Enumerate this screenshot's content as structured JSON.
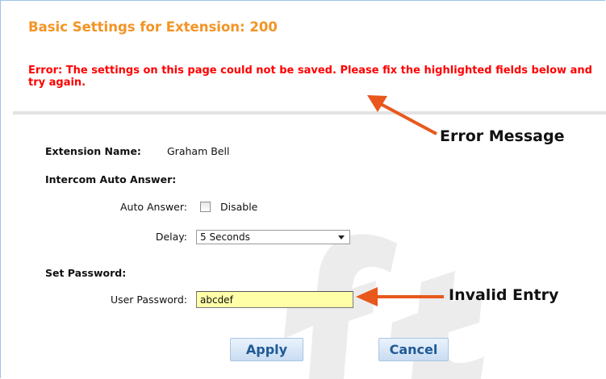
{
  "page": {
    "title": "Basic Settings for Extension: 200",
    "error_message": "Error: The settings on this page could not be saved. Please fix the highlighted fields below and try again."
  },
  "form": {
    "extension_name_label": "Extension Name:",
    "extension_name_value": "Graham Bell",
    "intercom_heading": "Intercom Auto Answer:",
    "auto_answer_label": "Auto Answer:",
    "auto_answer_checkbox_label": "Disable",
    "auto_answer_checked": false,
    "delay_label": "Delay:",
    "delay_value": "5 Seconds",
    "password_heading": "Set Password:",
    "user_password_label": "User Password:",
    "user_password_value": "abcdef"
  },
  "buttons": {
    "apply": "Apply",
    "cancel": "Cancel"
  },
  "annotations": {
    "error_message_callout": "Error Message",
    "invalid_entry_callout": "Invalid Entry"
  },
  "colors": {
    "title": "#f39425",
    "error": "#ff0000",
    "arrow": "#e8581c",
    "invalid_field_bg": "#ffffa8",
    "button_text": "#1f5a96"
  }
}
